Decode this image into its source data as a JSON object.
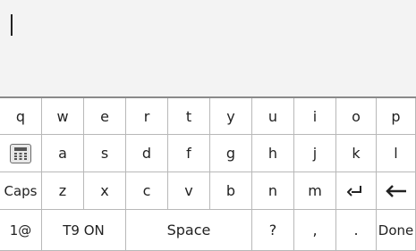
{
  "keyboard": {
    "row1": [
      "q",
      "w",
      "e",
      "r",
      "t",
      "y",
      "u",
      "i",
      "o",
      "p"
    ],
    "row2": [
      "a",
      "s",
      "d",
      "f",
      "g",
      "h",
      "j",
      "k",
      "l"
    ],
    "row3": [
      "Caps",
      "z",
      "x",
      "c",
      "v",
      "b",
      "n",
      "m"
    ],
    "row4": {
      "symbols": "1@",
      "t9": "T9 ON",
      "space": "Space",
      "question": "?",
      "comma": ",",
      "period": ".",
      "done": "Done"
    },
    "icons": {
      "calculator": "calculator-icon",
      "enter": "enter-icon",
      "backspace": "backspace-icon"
    }
  }
}
